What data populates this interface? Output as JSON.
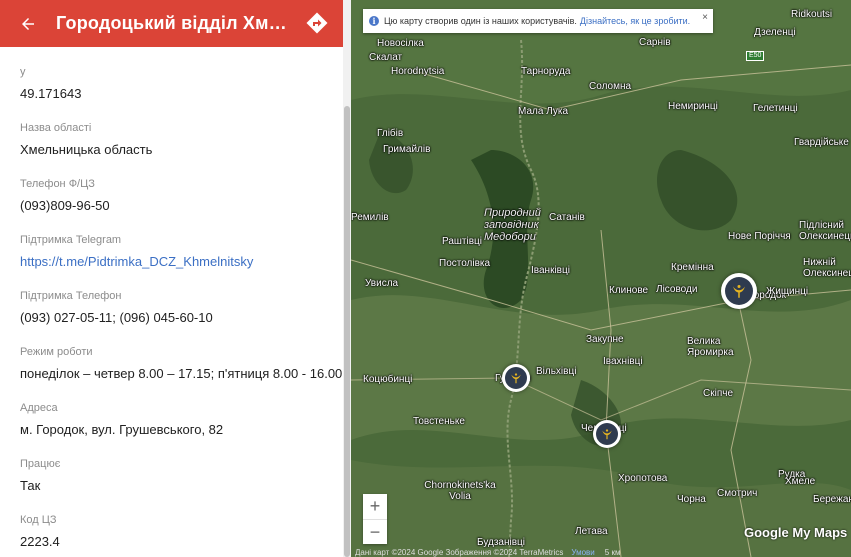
{
  "header": {
    "title": "Городоцький відділ Хмельн…"
  },
  "fields": [
    {
      "label": "y",
      "value": "49.171643"
    },
    {
      "label": "Назва області",
      "value": "Хмельницька область"
    },
    {
      "label": "Телефон Ф/ЦЗ",
      "value": "(093)809-96-50"
    },
    {
      "label": "Підтримка Telegram",
      "value": "https://t.me/Pidtrimka_DCZ_Khmelnitsky"
    },
    {
      "label": "Підтримка Телефон",
      "value": "(093) 027-05-11; (096) 045-60-10"
    },
    {
      "label": "Режим роботи",
      "value": "понеділок – четвер 8.00 – 17.15; п'ятниця 8.00 - 16.00."
    },
    {
      "label": "Адреса",
      "value": "м. Городок, вул. Грушевського, 82"
    },
    {
      "label": "Працює",
      "value": "Так"
    },
    {
      "label": "Код ЦЗ",
      "value": "2223.4"
    }
  ],
  "map": {
    "notice": {
      "text": "Цю карту створив один із наших користувачів.",
      "link": "Дізнайтесь, як це зробити.",
      "close": "×"
    },
    "places": [
      "Новосілка",
      "Скалат",
      "Horodnytsia",
      "Тарнорудa",
      "Соломна",
      "Сарнів",
      "Дзеленці",
      "Ridkoutsi",
      "Мала Лука",
      "Немиринці",
      "Гелетинці",
      "Гвардійське",
      "Глібів",
      "Гримайлів",
      "Природний заповідник Медобори",
      "Сатанів",
      "Ремилів",
      "Раштівці",
      "Нове Поріччя",
      "Підлісний Олексинець",
      "Постолівка",
      "Іванківці",
      "Кремінна",
      "Нижній Олексинець",
      "Увисла",
      "Клинове",
      "Лісоводи",
      "Городок",
      "Жищинці",
      "Закупне",
      "Велика Яромирка",
      "Івахнівці",
      "Вільхівці",
      "Гусятин",
      "Коцюбинці",
      "Скіпче",
      "Товстеньке",
      "Чемерівці",
      "Хропотова",
      "Рудка",
      "Chornokinets'ka Volia",
      "Хмеле",
      "Чорна",
      "Смотрич",
      "Бережанка",
      "Летава",
      "Будзанівці"
    ],
    "highway": "E50",
    "zoom_in": "+",
    "zoom_out": "−",
    "footer_data": "Дані карт ©2024 Google Зображення ©2024 TerraMetrics",
    "footer_terms": "Умови",
    "footer_scale": "5 км",
    "brand": "Google My Maps"
  },
  "colors": {
    "header_bg": "#db4437",
    "link": "#3b6fc4"
  }
}
